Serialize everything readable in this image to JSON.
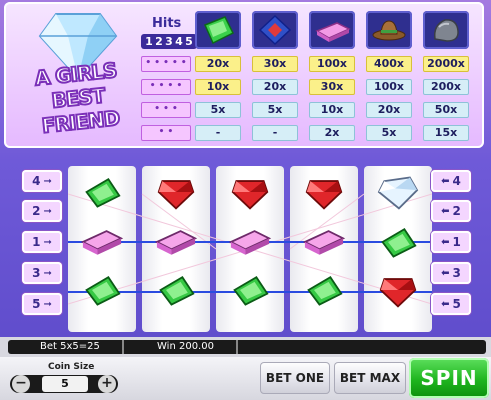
{
  "paytable": {
    "logo_text_line1": "A GIRLS",
    "logo_text_line2": "BEST FRIEND",
    "hits_label": "Hits",
    "hits_numbers": [
      "1",
      "2",
      "3",
      "4",
      "5"
    ],
    "symbols": [
      "green-gem",
      "blue-gem",
      "pink-bar",
      "brown-cowboy-hat",
      "grey-stone"
    ],
    "rows": [
      {
        "hits_key": "• • • • •",
        "values": [
          "20x",
          "30x",
          "100x",
          "400x",
          "2000x"
        ],
        "highlight": [
          true,
          true,
          true,
          true,
          true
        ]
      },
      {
        "hits_key": "• • • •",
        "values": [
          "10x",
          "20x",
          "30x",
          "100x",
          "200x"
        ],
        "highlight": [
          true,
          false,
          true,
          false,
          false
        ]
      },
      {
        "hits_key": "• • •",
        "values": [
          "5x",
          "5x",
          "10x",
          "20x",
          "50x"
        ],
        "highlight": [
          false,
          false,
          false,
          false,
          false
        ]
      },
      {
        "hits_key": "• •",
        "values": [
          "-",
          "-",
          "2x",
          "5x",
          "15x"
        ],
        "highlight": [
          false,
          false,
          false,
          false,
          false
        ]
      }
    ]
  },
  "lines": {
    "left": [
      "4",
      "2",
      "1",
      "3",
      "5"
    ],
    "right": [
      "4",
      "2",
      "1",
      "3",
      "5"
    ]
  },
  "reels": [
    [
      "green-gem",
      "pink-bar",
      "green-gem"
    ],
    [
      "red-gem",
      "pink-bar",
      "green-gem"
    ],
    [
      "red-gem",
      "pink-bar",
      "green-gem"
    ],
    [
      "red-gem",
      "pink-bar",
      "green-gem"
    ],
    [
      "white-diamond",
      "green-gem",
      "red-gem"
    ]
  ],
  "status": {
    "bet_text": "Bet 5x5=25",
    "win_text": "Win 200.00"
  },
  "controls": {
    "coin_size_label": "Coin Size",
    "coin_value": "5",
    "minus": "−",
    "plus": "+",
    "bet_one": "BET ONE",
    "bet_max": "BET MAX",
    "spin": "SPIN"
  },
  "colors": {
    "background": "#6a50c8",
    "spin_green": "#1fb51f",
    "payline_blue": "#2a4be0",
    "highlight_yellow": "#fbf08a"
  }
}
